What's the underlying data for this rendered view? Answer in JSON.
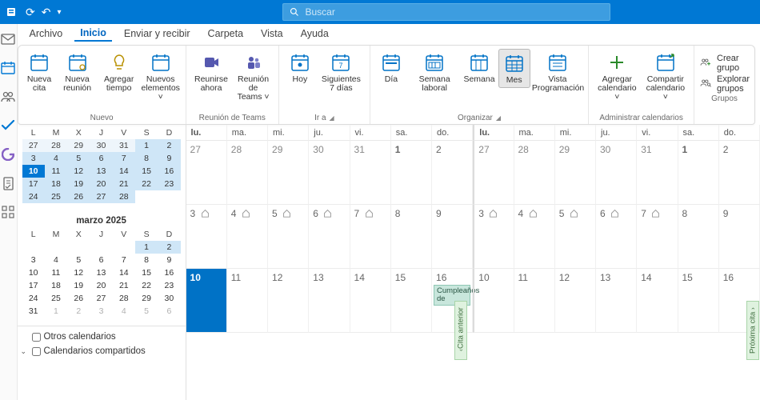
{
  "titlebar": {
    "search_placeholder": "Buscar"
  },
  "menu": {
    "items": [
      "Archivo",
      "Inicio",
      "Enviar y recibir",
      "Carpeta",
      "Vista",
      "Ayuda"
    ],
    "active": 1
  },
  "ribbon": {
    "groups": [
      {
        "caption": "Nuevo",
        "dlg": false,
        "buttons": [
          {
            "label": "Nueva cita",
            "icon": "calendar-plus"
          },
          {
            "label": "Nueva reunión",
            "icon": "calendar-people"
          },
          {
            "label": "Agregar tiempo",
            "icon": "lightbulb"
          },
          {
            "label": "Nuevos elementos ˅",
            "icon": "new-items"
          }
        ]
      },
      {
        "caption": "Reunión de Teams",
        "dlg": false,
        "buttons": [
          {
            "label": "Reunirse ahora",
            "icon": "teams-now"
          },
          {
            "label": "Reunión de Teams ˅",
            "icon": "teams"
          }
        ]
      },
      {
        "caption": "Ir a",
        "dlg": true,
        "buttons": [
          {
            "label": "Hoy",
            "icon": "cal-today"
          },
          {
            "label": "Siguientes 7 días",
            "icon": "cal-7"
          }
        ]
      },
      {
        "caption": "Organizar",
        "dlg": true,
        "buttons": [
          {
            "label": "Día",
            "icon": "cal-day"
          },
          {
            "label": "Semana laboral",
            "icon": "cal-ww"
          },
          {
            "label": "Semana",
            "icon": "cal-week"
          },
          {
            "label": "Mes",
            "icon": "cal-month",
            "selected": true
          },
          {
            "label": "Vista Programación",
            "icon": "cal-sched"
          }
        ]
      },
      {
        "caption": "Administrar calendarios",
        "dlg": false,
        "buttons": [
          {
            "label": "Agregar calendario ˅",
            "icon": "cal-add"
          },
          {
            "label": "Compartir calendario ˅",
            "icon": "cal-share"
          }
        ]
      },
      {
        "caption": "Grupos",
        "dlg": false,
        "side": [
          {
            "label": "Crear grupo",
            "icon": "people-plus"
          },
          {
            "label": "Explorar grupos",
            "icon": "people-search"
          }
        ]
      }
    ]
  },
  "minicals": [
    {
      "title": "",
      "dow": [
        "L",
        "M",
        "X",
        "J",
        "V",
        "S",
        "D"
      ],
      "rows": [
        [
          {
            "n": 27,
            "c": "bdim"
          },
          {
            "n": 28,
            "c": "bdim"
          },
          {
            "n": 29,
            "c": "bdim"
          },
          {
            "n": 30,
            "c": "bdim"
          },
          {
            "n": 31,
            "c": "bdim"
          },
          {
            "n": 1,
            "c": "hl"
          },
          {
            "n": 2,
            "c": "hl"
          }
        ],
        [
          {
            "n": 3,
            "c": "hl"
          },
          {
            "n": 4,
            "c": "hl"
          },
          {
            "n": 5,
            "c": "hl"
          },
          {
            "n": 6,
            "c": "hl"
          },
          {
            "n": 7,
            "c": "hl"
          },
          {
            "n": 8,
            "c": "hl"
          },
          {
            "n": 9,
            "c": "hl"
          }
        ],
        [
          {
            "n": 10,
            "c": "today"
          },
          {
            "n": 11,
            "c": "hl"
          },
          {
            "n": 12,
            "c": "hl"
          },
          {
            "n": 13,
            "c": "hl"
          },
          {
            "n": 14,
            "c": "hl"
          },
          {
            "n": 15,
            "c": "hl"
          },
          {
            "n": 16,
            "c": "hl"
          }
        ],
        [
          {
            "n": 17,
            "c": "hl"
          },
          {
            "n": 18,
            "c": "hl"
          },
          {
            "n": 19,
            "c": "hl"
          },
          {
            "n": 20,
            "c": "hl"
          },
          {
            "n": 21,
            "c": "hl"
          },
          {
            "n": 22,
            "c": "hl"
          },
          {
            "n": 23,
            "c": "hl"
          }
        ],
        [
          {
            "n": 24,
            "c": "hl"
          },
          {
            "n": 25,
            "c": "hl"
          },
          {
            "n": 26,
            "c": "hl"
          },
          {
            "n": 27,
            "c": "hl"
          },
          {
            "n": 28,
            "c": "hl"
          },
          {
            "n": ""
          },
          {
            "n": ""
          }
        ]
      ]
    },
    {
      "title": "marzo 2025",
      "dow": [
        "L",
        "M",
        "X",
        "J",
        "V",
        "S",
        "D"
      ],
      "rows": [
        [
          {
            "n": ""
          },
          {
            "n": ""
          },
          {
            "n": ""
          },
          {
            "n": ""
          },
          {
            "n": ""
          },
          {
            "n": 1,
            "c": "hl"
          },
          {
            "n": 2,
            "c": "hl"
          }
        ],
        [
          {
            "n": 3
          },
          {
            "n": 4
          },
          {
            "n": 5
          },
          {
            "n": 6
          },
          {
            "n": 7
          },
          {
            "n": 8
          },
          {
            "n": 9
          }
        ],
        [
          {
            "n": 10
          },
          {
            "n": 11
          },
          {
            "n": 12
          },
          {
            "n": 13
          },
          {
            "n": 14
          },
          {
            "n": 15
          },
          {
            "n": 16
          }
        ],
        [
          {
            "n": 17
          },
          {
            "n": 18
          },
          {
            "n": 19
          },
          {
            "n": 20
          },
          {
            "n": 21
          },
          {
            "n": 22
          },
          {
            "n": 23
          }
        ],
        [
          {
            "n": 24
          },
          {
            "n": 25
          },
          {
            "n": 26
          },
          {
            "n": 27
          },
          {
            "n": 28
          },
          {
            "n": 29
          },
          {
            "n": 30
          }
        ],
        [
          {
            "n": 31
          },
          {
            "n": 1,
            "c": "dim"
          },
          {
            "n": 2,
            "c": "dim"
          },
          {
            "n": 3,
            "c": "dim"
          },
          {
            "n": 4,
            "c": "dim"
          },
          {
            "n": 5,
            "c": "dim"
          },
          {
            "n": 6,
            "c": "dim"
          }
        ]
      ]
    }
  ],
  "caltree": {
    "other": "Otros calendarios",
    "shared": "Calendarios compartidos"
  },
  "grid": {
    "dow": [
      "lu.",
      "ma.",
      "mi.",
      "ju.",
      "vi.",
      "sa.",
      "do."
    ],
    "weeks": [
      {
        "left": [
          {
            "n": 27,
            "dim": true
          },
          {
            "n": 28,
            "dim": true
          },
          {
            "n": 29,
            "dim": true
          },
          {
            "n": 30,
            "dim": true
          },
          {
            "n": 31,
            "dim": true
          },
          {
            "n": 1,
            "bold": true
          },
          {
            "n": 2
          }
        ],
        "right": [
          {
            "n": 27,
            "dim": true
          },
          {
            "n": 28,
            "dim": true
          },
          {
            "n": 29,
            "dim": true
          },
          {
            "n": 30,
            "dim": true
          },
          {
            "n": 31,
            "dim": true
          },
          {
            "n": 1,
            "bold": true
          },
          {
            "n": 2
          }
        ]
      },
      {
        "left": [
          {
            "n": 3,
            "home": true
          },
          {
            "n": 4,
            "home": true
          },
          {
            "n": 5,
            "home": true
          },
          {
            "n": 6,
            "home": true
          },
          {
            "n": 7,
            "home": true
          },
          {
            "n": 8
          },
          {
            "n": 9
          }
        ],
        "right": [
          {
            "n": 3,
            "home": true
          },
          {
            "n": 4,
            "home": true
          },
          {
            "n": 5,
            "home": true
          },
          {
            "n": 6,
            "home": true
          },
          {
            "n": 7,
            "home": true
          },
          {
            "n": 8
          },
          {
            "n": 9
          }
        ]
      },
      {
        "left": [
          {
            "n": 10,
            "today": true
          },
          {
            "n": 11
          },
          {
            "n": 12
          },
          {
            "n": 13
          },
          {
            "n": 14
          },
          {
            "n": 15
          },
          {
            "n": 16,
            "event": "Cumpleaños de"
          }
        ],
        "right": [
          {
            "n": 10
          },
          {
            "n": 11
          },
          {
            "n": 12
          },
          {
            "n": 13
          },
          {
            "n": 14
          },
          {
            "n": 15
          },
          {
            "n": 16
          }
        ]
      }
    ],
    "prev_label": "Cita anterior",
    "next_label": "Próxima cita"
  }
}
